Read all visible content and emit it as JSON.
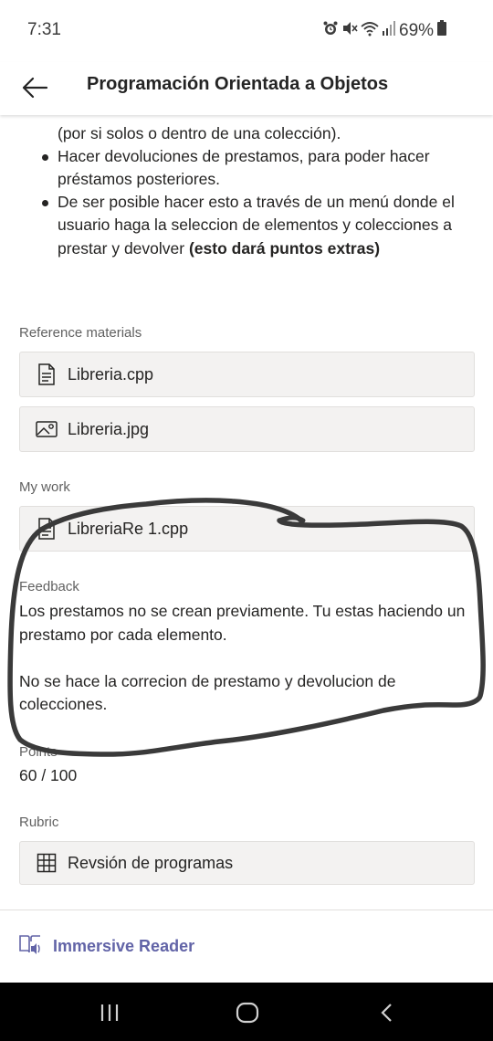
{
  "status_bar": {
    "time": "7:31",
    "battery": "69%",
    "icons": [
      "alarm-icon",
      "mute-icon",
      "wifi-icon",
      "signal-icon",
      "battery-icon"
    ]
  },
  "header": {
    "back_icon": "back-arrow-icon",
    "title": "Programación Orientada a Objetos"
  },
  "instructions": {
    "partial_line": "(por si solos o dentro de una colección).",
    "bullets": [
      {
        "lines": [
          "Hacer devoluciones de prestamos, para poder hacer",
          "préstamos posteriores."
        ]
      },
      {
        "lines": [
          "De ser posible hacer esto a través de un menú donde el",
          "usuario haga la seleccion de elementos y colecciones a"
        ],
        "last_line_plain": "prestar y devolver ",
        "last_line_bold": "(esto dará puntos extras)"
      }
    ]
  },
  "reference_materials": {
    "label": "Reference materials",
    "files": [
      {
        "name": "Libreria.cpp",
        "icon": "document-icon"
      },
      {
        "name": "Libreria.jpg",
        "icon": "image-icon"
      }
    ]
  },
  "my_work": {
    "label": "My work",
    "files": [
      {
        "name": "LibreriaRe 1.cpp",
        "icon": "document-icon"
      }
    ]
  },
  "feedback": {
    "label": "Feedback",
    "paragraph1_lines": [
      "Los prestamos no se crean previamente. Tu estas haciendo un",
      "prestamo por cada elemento."
    ],
    "paragraph2_lines": [
      "No se hace la correcion de prestamo y devolucion de",
      "colecciones."
    ]
  },
  "points": {
    "label": "Points",
    "value": "60 / 100"
  },
  "rubric": {
    "label": "Rubric",
    "item": {
      "name": "Revsión de programas",
      "icon": "grid-icon"
    }
  },
  "footer": {
    "reader_label": "Immersive Reader",
    "reader_icon": "immersive-reader-icon"
  },
  "nav_bar": {
    "buttons": [
      "recent-apps-icon",
      "home-icon",
      "back-icon"
    ]
  },
  "colors": {
    "accent": "#6264a7",
    "card_bg": "#f3f2f1",
    "annotation_stroke": "#3a3a3a"
  }
}
